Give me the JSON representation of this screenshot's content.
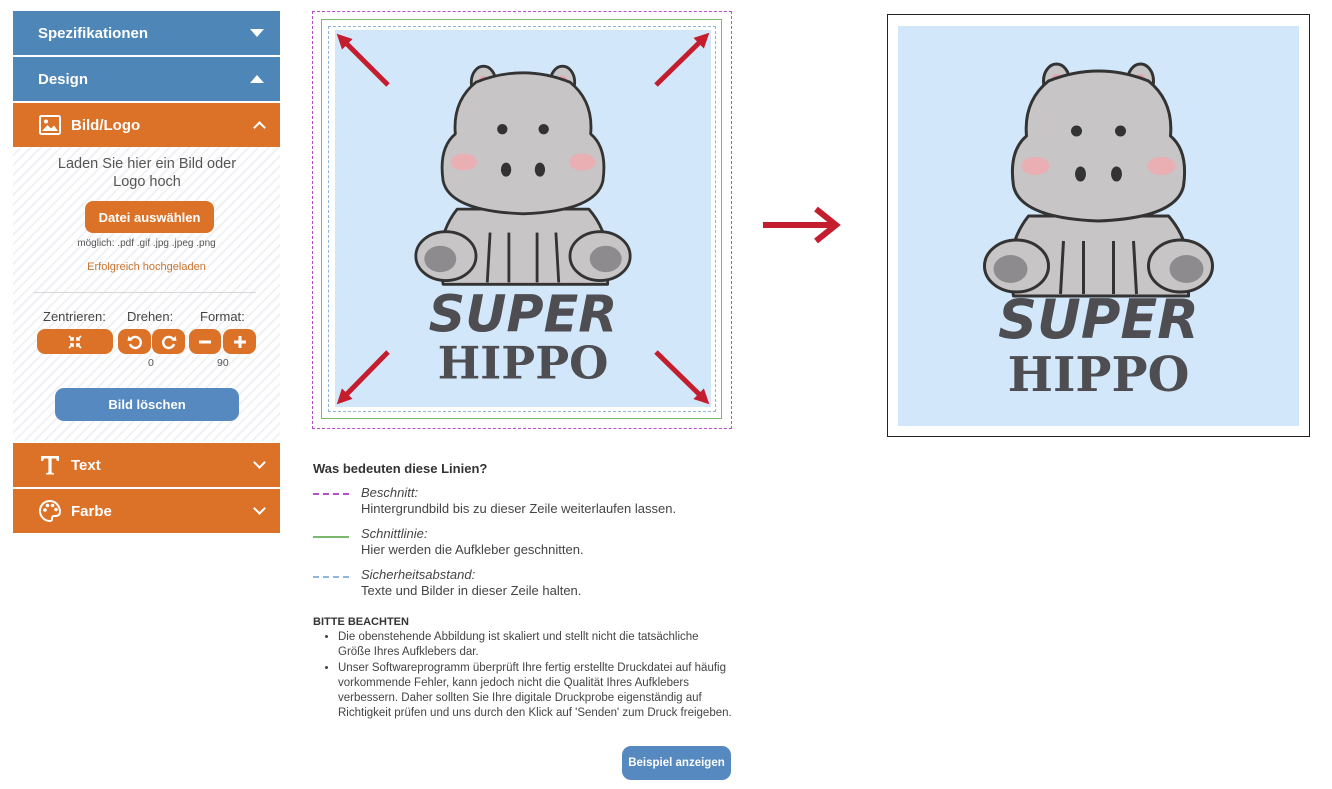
{
  "sidebar": {
    "spezifikationen": "Spezifikationen",
    "design": "Design",
    "bildlogo": "Bild/Logo",
    "upload_text": "Laden Sie hier ein Bild oder Logo hoch",
    "file_button": "Datei auswählen",
    "formats": "möglich: .pdf .gif .jpg .jpeg .png",
    "success": "Erfolgreich hochgeladen",
    "centering_label": "Zentrieren:",
    "rotate_label": "Drehen:",
    "format_label": "Format:",
    "rotate_value": "0",
    "format_value": "90",
    "delete_button": "Bild löschen",
    "text": "Text",
    "farbe": "Farbe"
  },
  "artwork": {
    "line1": "SUPER",
    "line2": "HIPPO",
    "background": "#d3e7fa",
    "arrow_color": "#c41e2e"
  },
  "legend": {
    "title": "Was bedeuten diese Linien?",
    "items": [
      {
        "name": "Beschnitt:",
        "desc": "Hintergrundbild bis zu dieser Zeile weiterlaufen lassen.",
        "color": "#b44fc8"
      },
      {
        "name": "Schnittlinie:",
        "desc": "Hier werden die Aufkleber geschnitten.",
        "color": "#7cb96a"
      },
      {
        "name": "Sicherheitsabstand:",
        "desc": "Texte und Bilder in dieser Zeile halten.",
        "color": "#8fb5dc"
      }
    ]
  },
  "notes": {
    "title": "BITTE BEACHTEN",
    "items": [
      "Die obenstehende Abbildung ist skaliert und stellt nicht die tatsächliche Größe Ihres Aufklebers dar.",
      "Unser Softwareprogramm überprüft Ihre fertig erstellte Druckdatei auf häufig vorkommende Fehler, kann jedoch nicht die Qualität Ihres Aufklebers verbessern. Daher sollten Sie Ihre digitale Druckprobe eigenständig auf Richtigkeit prüfen und uns durch den Klick auf 'Senden' zum Druck freigeben."
    ]
  },
  "example_button": "Beispiel anzeigen"
}
